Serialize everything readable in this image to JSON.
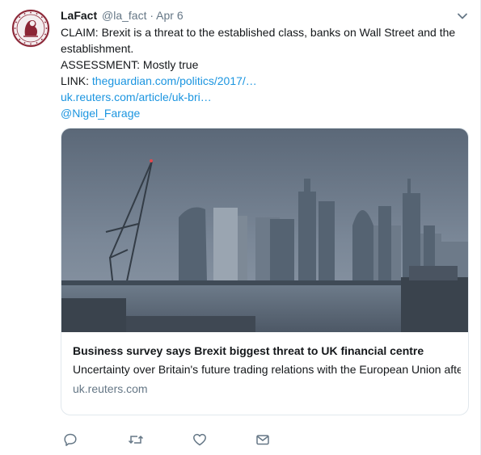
{
  "tweet": {
    "display_name": "LaFact",
    "handle": "@la_fact",
    "separator": "·",
    "time": "Apr 6",
    "lines": {
      "claim": "CLAIM: Brexit is a threat to the established class, banks on Wall Street and the establishment.",
      "assessment": "ASSESSMENT: Mostly true",
      "link_label": "LINK: ",
      "link1": "theguardian.com/politics/2017/…",
      "link2": "uk.reuters.com/article/uk-bri…",
      "mention": "@Nigel_Farage"
    }
  },
  "card": {
    "title": "Business survey says Brexit biggest threat to UK financial centre",
    "description": "Uncertainty over Britain's future trading relations with the European Union after Brexit is the most serious threat to London as the world's top financial",
    "domain": "uk.reuters.com"
  },
  "icons": {
    "caret": "chevron-down-icon",
    "reply": "reply-icon",
    "retweet": "retweet-icon",
    "like": "heart-icon",
    "dm": "envelope-icon"
  },
  "colors": {
    "link": "#1b95e0",
    "secondary_text": "#657786",
    "avatar_brand": "#8b2535"
  }
}
